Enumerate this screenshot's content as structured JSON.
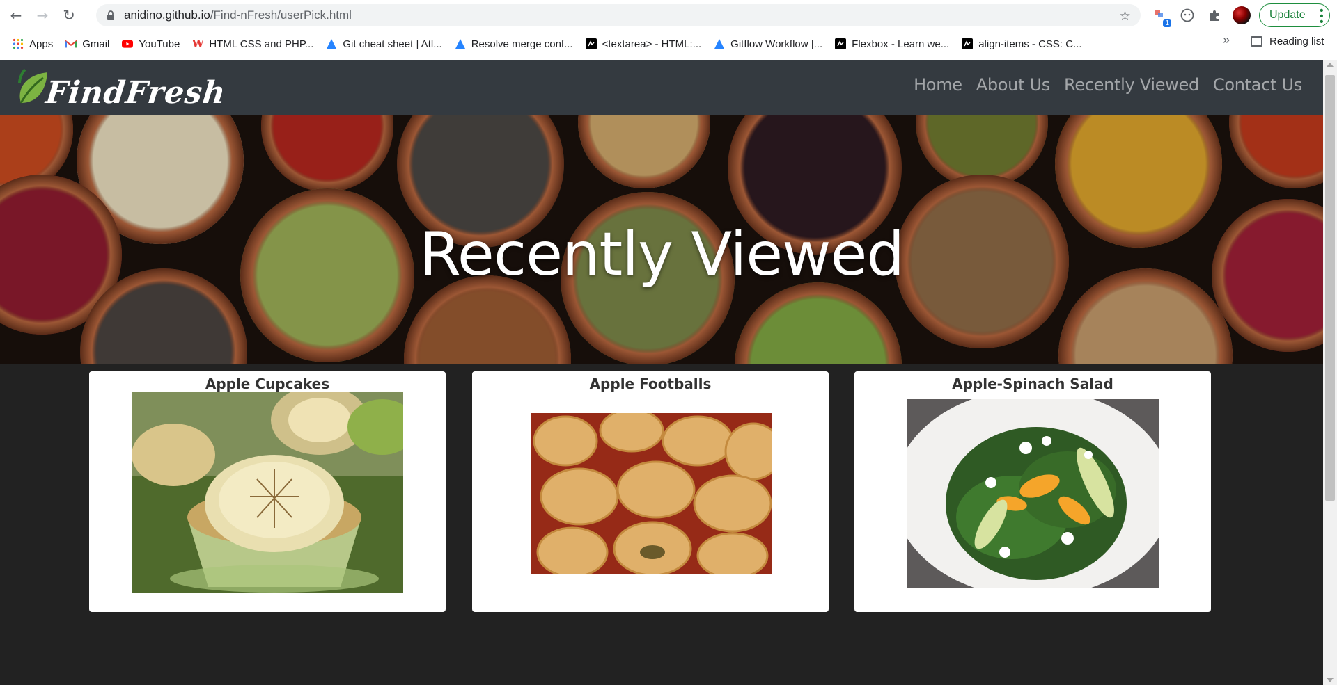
{
  "browser": {
    "url_domain": "anidino.github.io",
    "url_path": "/Find-nFresh/userPick.html",
    "update_label": "Update",
    "extension_badge": "1",
    "bookmarks": [
      {
        "label": "Apps",
        "icon": "apps-grid-icon"
      },
      {
        "label": "Gmail",
        "icon": "gmail-icon"
      },
      {
        "label": "YouTube",
        "icon": "youtube-icon"
      },
      {
        "label": "HTML CSS and PHP...",
        "icon": "w-icon"
      },
      {
        "label": "Git cheat sheet | Atl...",
        "icon": "atlassian-icon"
      },
      {
        "label": "Resolve merge conf...",
        "icon": "atlassian-icon"
      },
      {
        "label": "<textarea> - HTML:...",
        "icon": "mdn-icon"
      },
      {
        "label": "Gitflow Workflow |...",
        "icon": "atlassian-icon"
      },
      {
        "label": "Flexbox - Learn we...",
        "icon": "mdn-icon"
      },
      {
        "label": "align-items - CSS: C...",
        "icon": "mdn-icon"
      }
    ],
    "more_bookmarks": "»",
    "reading_list": "Reading list"
  },
  "site": {
    "logo_text": "FindFresh",
    "nav": [
      "Home",
      "About Us",
      "Recently Viewed",
      "Contact Us"
    ],
    "hero_title": "Recently Viewed"
  },
  "cards": [
    {
      "title": "Apple Cupcakes"
    },
    {
      "title": "Apple Footballs"
    },
    {
      "title": "Apple-Spinach Salad"
    }
  ],
  "colors": {
    "navbar": "#343a40",
    "page_bg": "#222222",
    "update_green": "#188038"
  }
}
